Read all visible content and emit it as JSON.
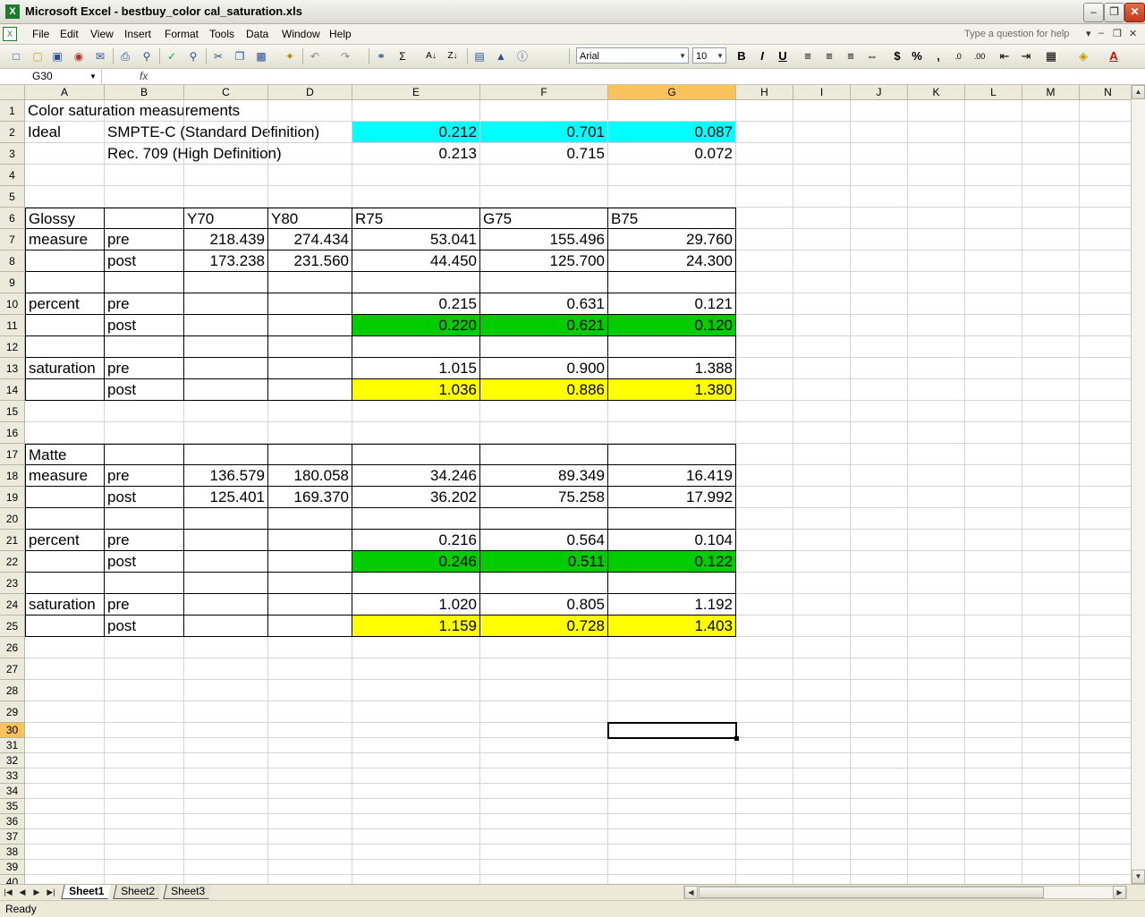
{
  "window": {
    "title": "Microsoft Excel - bestbuy_color cal_saturation.xls"
  },
  "menu": [
    "File",
    "Edit",
    "View",
    "Insert",
    "Format",
    "Tools",
    "Data",
    "Window",
    "Help"
  ],
  "help_placeholder": "Type a question for help",
  "formatting": {
    "font_name": "Arial",
    "font_size": "10"
  },
  "formula": {
    "name_box": "G30",
    "fx": "fx",
    "content": ""
  },
  "columns": [
    "A",
    "B",
    "C",
    "D",
    "E",
    "F",
    "G",
    "H",
    "I",
    "J",
    "K",
    "L",
    "M",
    "N"
  ],
  "active_cell": {
    "column": "G",
    "row": 30
  },
  "rows_visible": 40,
  "cells": {
    "A1": "Color saturation measurements",
    "A2": "Ideal",
    "B2": "SMPTE-C (Standard Definition)",
    "E2": "0.212",
    "F2": "0.701",
    "G2": "0.087",
    "B3": "Rec. 709 (High Definition)",
    "E3": "0.213",
    "F3": "0.715",
    "G3": "0.072",
    "A6": "Glossy",
    "C6": "Y70",
    "D6": "Y80",
    "E6": "R75",
    "F6": "G75",
    "G6": "B75",
    "A7": "measure",
    "B7": "pre",
    "C7": "218.439",
    "D7": "274.434",
    "E7": "53.041",
    "F7": "155.496",
    "G7": "29.760",
    "B8": "post",
    "C8": "173.238",
    "D8": "231.560",
    "E8": "44.450",
    "F8": "125.700",
    "G8": "24.300",
    "A10": "percent",
    "B10": "pre",
    "E10": "0.215",
    "F10": "0.631",
    "G10": "0.121",
    "B11": "post",
    "E11": "0.220",
    "F11": "0.621",
    "G11": "0.120",
    "A13": "saturation",
    "B13": "pre",
    "E13": "1.015",
    "F13": "0.900",
    "G13": "1.388",
    "B14": "post",
    "E14": "1.036",
    "F14": "0.886",
    "G14": "1.380",
    "A17": "Matte",
    "A18": "measure",
    "B18": "pre",
    "C18": "136.579",
    "D18": "180.058",
    "E18": "34.246",
    "F18": "89.349",
    "G18": "16.419",
    "B19": "post",
    "C19": "125.401",
    "D19": "169.370",
    "E19": "36.202",
    "F19": "75.258",
    "G19": "17.992",
    "A21": "percent",
    "B21": "pre",
    "E21": "0.216",
    "F21": "0.564",
    "G21": "0.104",
    "B22": "post",
    "E22": "0.246",
    "F22": "0.511",
    "G22": "0.122",
    "A24": "saturation",
    "B24": "pre",
    "E24": "1.020",
    "F24": "0.805",
    "G24": "1.192",
    "B25": "post",
    "E25": "1.159",
    "F25": "0.728",
    "G25": "1.403"
  },
  "fills": {
    "#00ffff": [
      "E2",
      "F2",
      "G2"
    ],
    "#00cc00": [
      "E11",
      "F11",
      "G11",
      "E22",
      "F22",
      "G22"
    ],
    "#ffff00": [
      "E14",
      "F14",
      "G14",
      "E25",
      "F25",
      "G25"
    ]
  },
  "sheets": [
    "Sheet1",
    "Sheet2",
    "Sheet3"
  ],
  "active_sheet": "Sheet1",
  "status": "Ready"
}
